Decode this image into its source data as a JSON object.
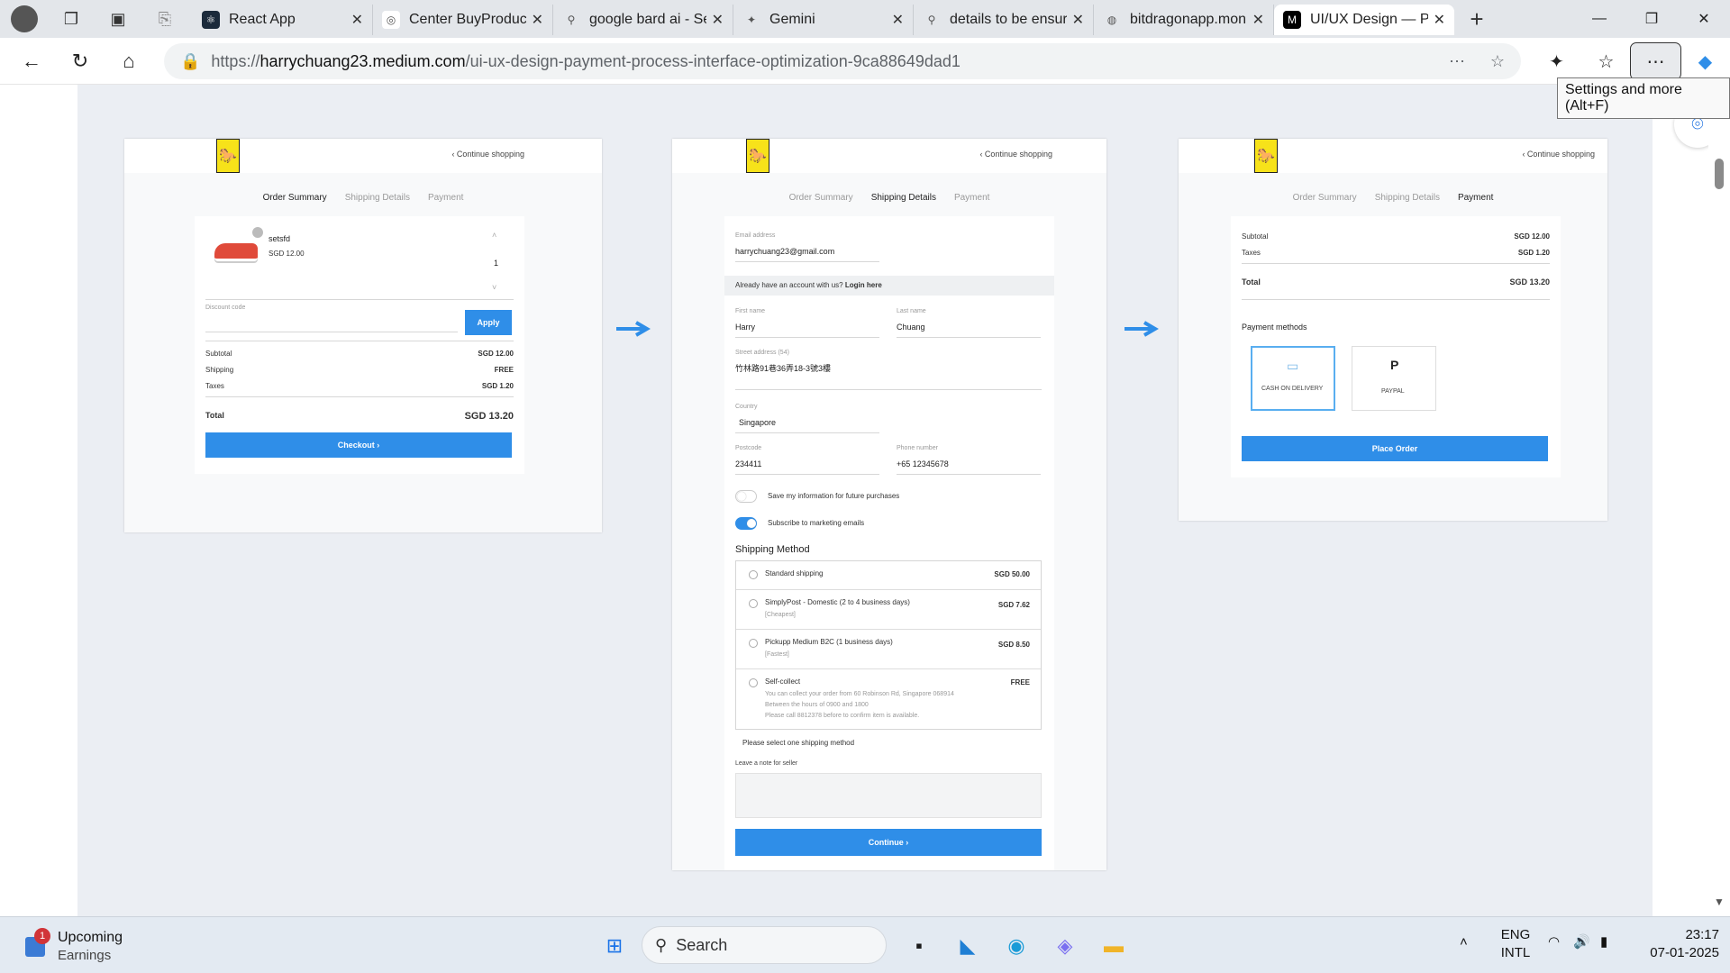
{
  "browser": {
    "tabs": [
      {
        "title": "React App",
        "icon": "react-icon",
        "color": "#1b2a3b"
      },
      {
        "title": "Center BuyProduct",
        "icon": "chatgpt-icon",
        "color": "#ffffff"
      },
      {
        "title": "google bard ai - Se",
        "icon": "search-icon",
        "color": "#e3e6ea"
      },
      {
        "title": "Gemini",
        "icon": "gemini-icon",
        "color": "#e3e6ea"
      },
      {
        "title": "details to be ensure",
        "icon": "search-icon",
        "color": "#e3e6ea"
      },
      {
        "title": "bitdragonapp.mon",
        "icon": "globe-icon",
        "color": "#e3e6ea"
      },
      {
        "title": "UI/UX Design — Pa",
        "icon": "medium-icon",
        "color": "#000000"
      }
    ],
    "new_tab": "+",
    "url_prefix": "https://",
    "url_host": "harrychuang23.medium.com",
    "url_path": "/ui-ux-design-payment-process-interface-optimization-9ca88649dad1",
    "tooltip": "Settings and more (Alt+F)"
  },
  "panel1": {
    "continue": "‹ Continue shopping",
    "steps": [
      "Order Summary",
      "Shipping Details",
      "Payment"
    ],
    "product_name": "setsfd",
    "product_price": "SGD 12.00",
    "quantity": "1",
    "discount_label": "Discount code",
    "apply": "Apply",
    "subtotal_label": "Subtotal",
    "subtotal": "SGD 12.00",
    "shipping_label": "Shipping",
    "shipping": "FREE",
    "taxes_label": "Taxes",
    "taxes": "SGD 1.20",
    "total_label": "Total",
    "total": "SGD 13.20",
    "checkout": "Checkout ›"
  },
  "panel2": {
    "continue": "‹ Continue shopping",
    "steps": [
      "Order Summary",
      "Shipping Details",
      "Payment"
    ],
    "email_label": "Email address",
    "email": "harrychuang23@gmail.com",
    "account_text": "Already have an account with us?",
    "login": "Login here",
    "first_label": "First name",
    "first": "Harry",
    "last_label": "Last name",
    "last": "Chuang",
    "street_label": "Street address (54)",
    "street": "竹林路91巷36弄18-3號3樓",
    "country_label": "Country",
    "country": "Singapore",
    "postcode_label": "Postcode",
    "postcode": "234411",
    "phone_label": "Phone number",
    "phone": "+65 12345678",
    "save_info": "Save my information for future purchases",
    "subscribe": "Subscribe to marketing emails",
    "shipping_method": "Shipping Method",
    "options": [
      {
        "name": "Standard shipping",
        "sub": "",
        "price": "SGD 50.00"
      },
      {
        "name": "SimplyPost - Domestic (2 to 4 business days)",
        "sub": "[Cheapest]",
        "price": "SGD 7.62"
      },
      {
        "name": "Pickupp Medium B2C (1 business days)",
        "sub": "[Fastest]",
        "price": "SGD 8.50"
      },
      {
        "name": "Self-collect",
        "sub": "You can collect your order from 60 Robinson Rd, Singapore 068914",
        "sub2": "Between the hours of 0900 and 1800",
        "sub3": "Please call 8812378 before to confirm item is available.",
        "price": "FREE"
      }
    ],
    "select_msg": "Please select one shipping method",
    "note_label": "Leave a note for seller",
    "continue_btn": "Continue ›"
  },
  "panel3": {
    "continue": "‹ Continue shopping",
    "steps": [
      "Order Summary",
      "Shipping Details",
      "Payment"
    ],
    "subtotal_label": "Subtotal",
    "subtotal": "SGD 12.00",
    "taxes_label": "Taxes",
    "taxes": "SGD 1.20",
    "total_label": "Total",
    "total": "SGD 13.20",
    "methods_label": "Payment methods",
    "cod": "CASH ON DELIVERY",
    "paypal": "PAYPAL",
    "place_order": "Place Order"
  },
  "taskbar": {
    "widget_title": "Upcoming",
    "widget_sub": "Earnings",
    "widget_badge": "1",
    "search": "Search",
    "lang1": "ENG",
    "lang2": "INTL",
    "time": "23:17",
    "date": "07-01-2025"
  },
  "colors": {
    "accent": "#2f8ee8",
    "canvas": "#ebeef3"
  }
}
